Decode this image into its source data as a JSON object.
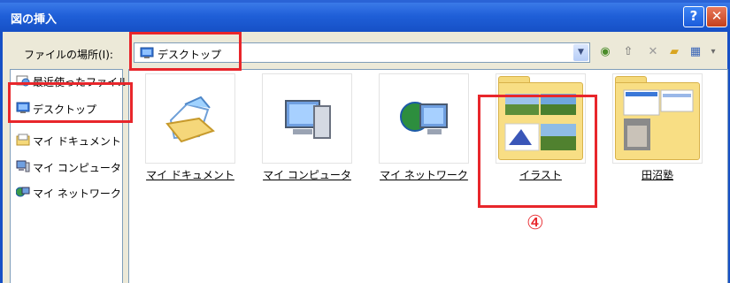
{
  "window": {
    "title": "図の挿入",
    "help_label": "?",
    "close_label": "✕"
  },
  "lookin": {
    "label": "ファイルの場所(I):",
    "value": "デスクトップ"
  },
  "places": [
    {
      "label": "最近使ったファイル"
    },
    {
      "label": "デスクトップ"
    },
    {
      "label": "マイ ドキュメント"
    },
    {
      "label": "マイ コンピュータ"
    },
    {
      "label": "マイ ネットワーク"
    }
  ],
  "files": [
    {
      "label": "マイ ドキュメント"
    },
    {
      "label": "マイ コンピュータ"
    },
    {
      "label": "マイ ネットワーク"
    },
    {
      "label": "イラスト"
    },
    {
      "label": "田沼塾"
    }
  ],
  "annotation": {
    "step": "④"
  },
  "colors": {
    "title_bar": "#1f5fd8",
    "highlight": "#e8262b",
    "dialog_bg": "#ece9d8"
  }
}
